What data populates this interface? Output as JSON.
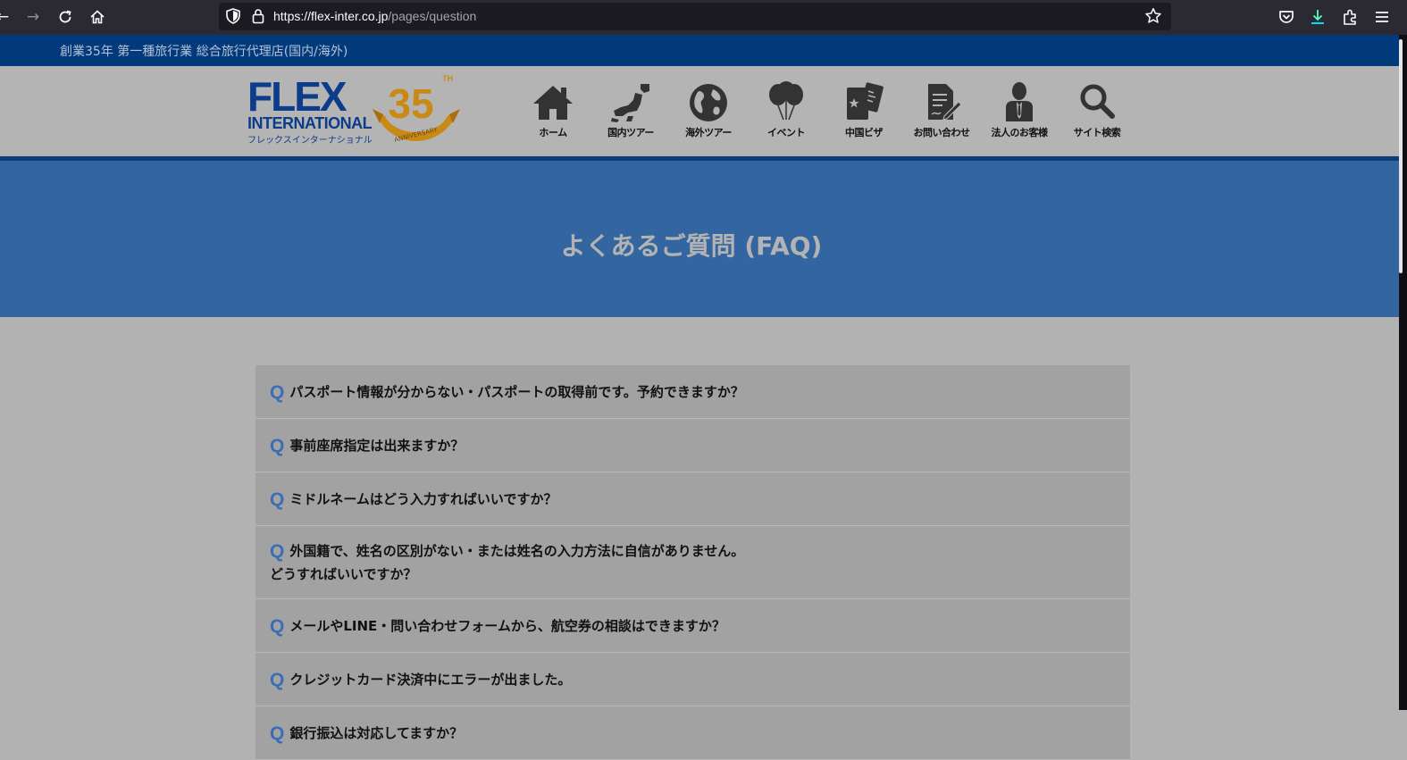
{
  "browser": {
    "url_host": "https://flex-inter.co.jp",
    "url_path": "/pages/question",
    "icons": [
      "back-icon",
      "forward-icon",
      "reload-icon",
      "home-icon",
      "shield-icon",
      "lock-icon",
      "bookmark-star-icon",
      "pocket-icon",
      "download-icon",
      "extensions-icon",
      "menu-icon"
    ]
  },
  "top_strip": {
    "text": "創業35年 第一種旅行業 総合旅行代理店(国内/海外)"
  },
  "logo": {
    "name": "FLEX",
    "sub": "INTERNATIONAL",
    "kana": "フレックスインターナショナル",
    "anniversary_number": "35",
    "anniversary_suffix": "TH",
    "anniversary_ribbon": "ANNIVERSARY"
  },
  "nav": [
    {
      "label": "ホーム",
      "icon": "house-icon"
    },
    {
      "label": "国内ツアー",
      "icon": "japan-map-icon"
    },
    {
      "label": "海外ツアー",
      "icon": "globe-icon"
    },
    {
      "label": "イベント",
      "icon": "balloons-icon"
    },
    {
      "label": "中国ビザ",
      "icon": "passport-icon"
    },
    {
      "label": "お問い合わせ",
      "icon": "document-pen-icon"
    },
    {
      "label": "法人のお客様",
      "icon": "businessman-icon"
    },
    {
      "label": "サイト検索",
      "icon": "search-icon"
    }
  ],
  "hero": {
    "title": "よくあるご質問 (FAQ)"
  },
  "faq": {
    "marker": "Q",
    "items": [
      "パスポート情報が分からない・パスポートの取得前です。予約できますか？",
      "事前座席指定は出来ますか？",
      "ミドルネームはどう入力すればいいですか？",
      "外国籍で、姓名の区別がない・または姓名の入力方法に自信がありません。\nどうすればいいですか？",
      "メールやLINE・問い合わせフォームから、航空券の相談はできますか？",
      "クレジットカード決済中にエラーが出ました。",
      "銀行振込は対応してますか？"
    ]
  },
  "colors": {
    "top_strip": "#003a7a",
    "hero": "#3366a0",
    "faq_bg": "#a2a2a2",
    "q_marker": "#3a6db5",
    "brand_blue": "#0d3c8a",
    "anniversary_gold": "#c88a14"
  }
}
